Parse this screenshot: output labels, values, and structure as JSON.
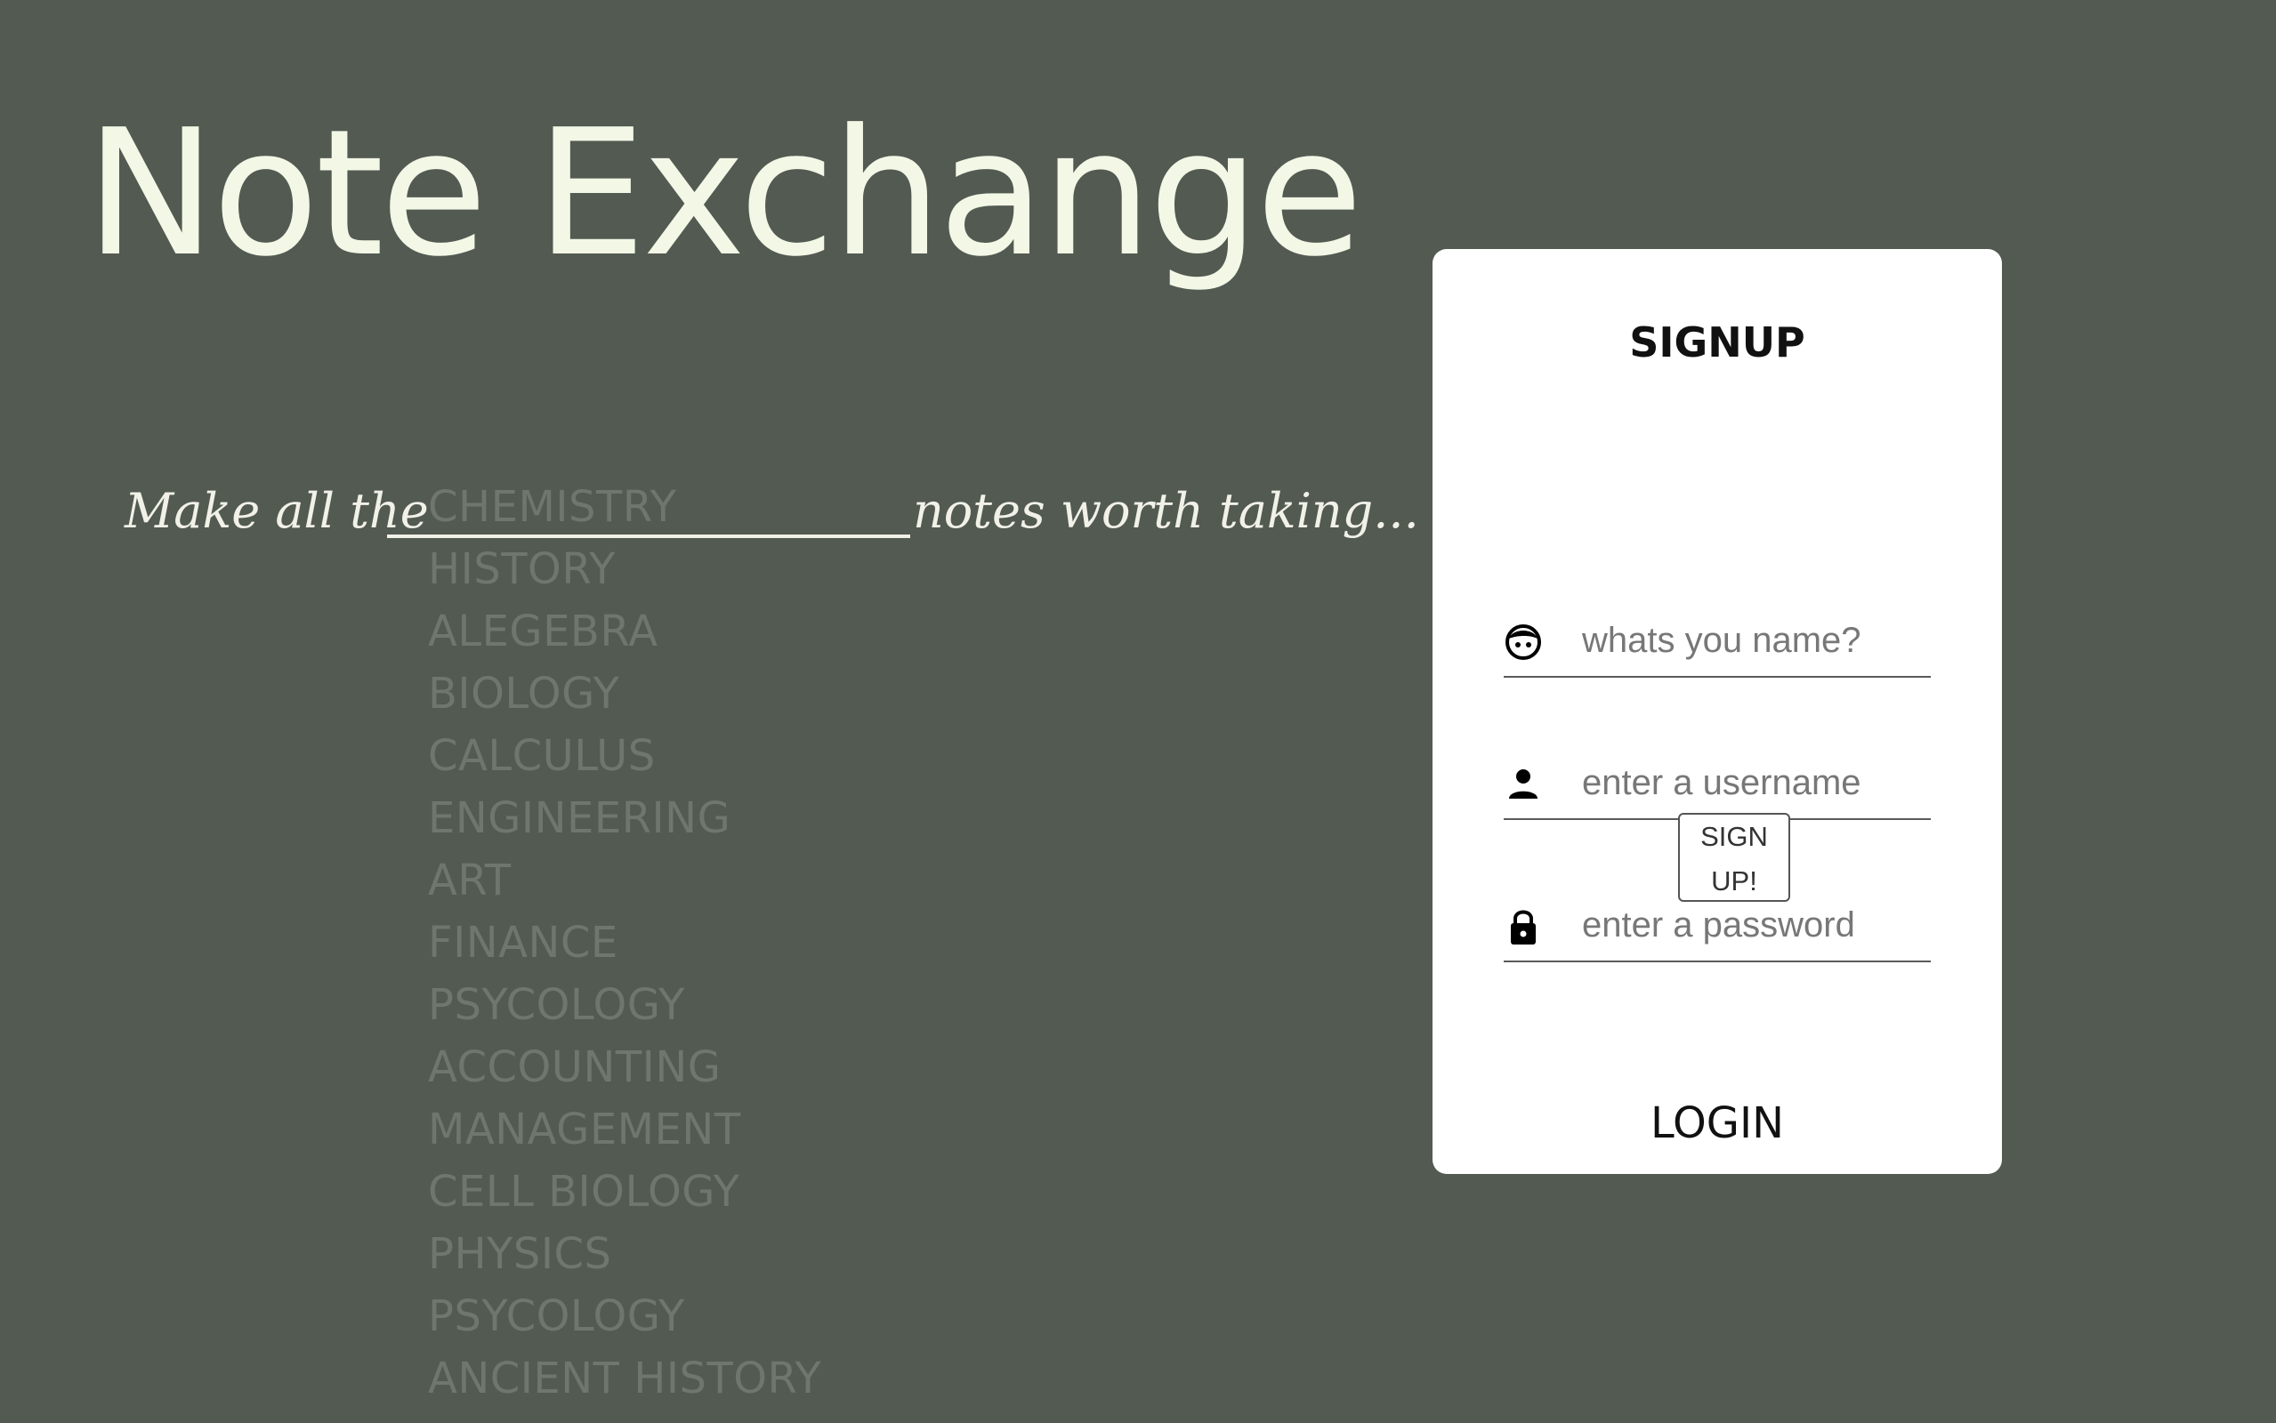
{
  "app": {
    "title": "Note Exchange",
    "background_color": "#525a52",
    "title_color": "#f3f7e6"
  },
  "tagline": {
    "prefix": "Make all the",
    "suffix": "notes worth taking..."
  },
  "subjects": [
    "CHEMISTRY",
    "HISTORY",
    "ALEGEBRA",
    "BIOLOGY",
    "CALCULUS",
    "ENGINEERING",
    "ART",
    "FINANCE",
    "PSYCOLOGY",
    "ACCOUNTING",
    "MANAGEMENT",
    "CELL BIOLOGY",
    "PHYSICS",
    "PSYCOLOGY",
    "ANCIENT HISTORY"
  ],
  "signup": {
    "title": "SIGNUP",
    "name_placeholder": "whats you name?",
    "name_icon": "face-icon",
    "username_placeholder": "enter a username",
    "username_icon": "person-icon",
    "password_placeholder": "enter a password",
    "password_icon": "lock-icon",
    "button_line1": "SIGN",
    "button_line2": "UP!",
    "login_label": "LOGIN"
  }
}
